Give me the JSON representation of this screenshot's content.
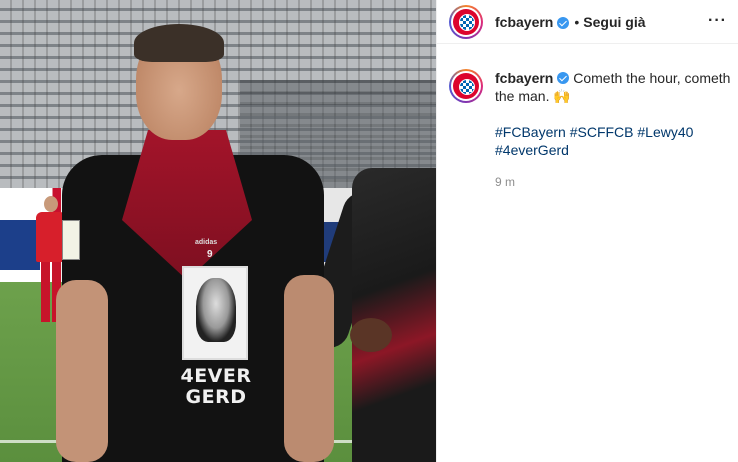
{
  "post": {
    "username": "fcbayern",
    "follow_label": "Segui già",
    "separator": "•",
    "more_label": "···",
    "verified": true
  },
  "caption": {
    "username": "fcbayern",
    "text": "Cometh the hour, cometh the man.",
    "emoji": "🙌",
    "hashtags": [
      "#FCBayern",
      "#SCFFCB",
      "#Lewy40",
      "#4everGerd"
    ],
    "time": "9 m"
  },
  "photo": {
    "shirt_print": [
      "4EVER",
      "GERD"
    ],
    "shirt_number": "9",
    "sponsor": "adidas"
  },
  "colors": {
    "link": "#00376b",
    "verified_badge": "#3897f0",
    "bayern_red": "#dc052d",
    "muted_text": "#8e8e8e"
  }
}
